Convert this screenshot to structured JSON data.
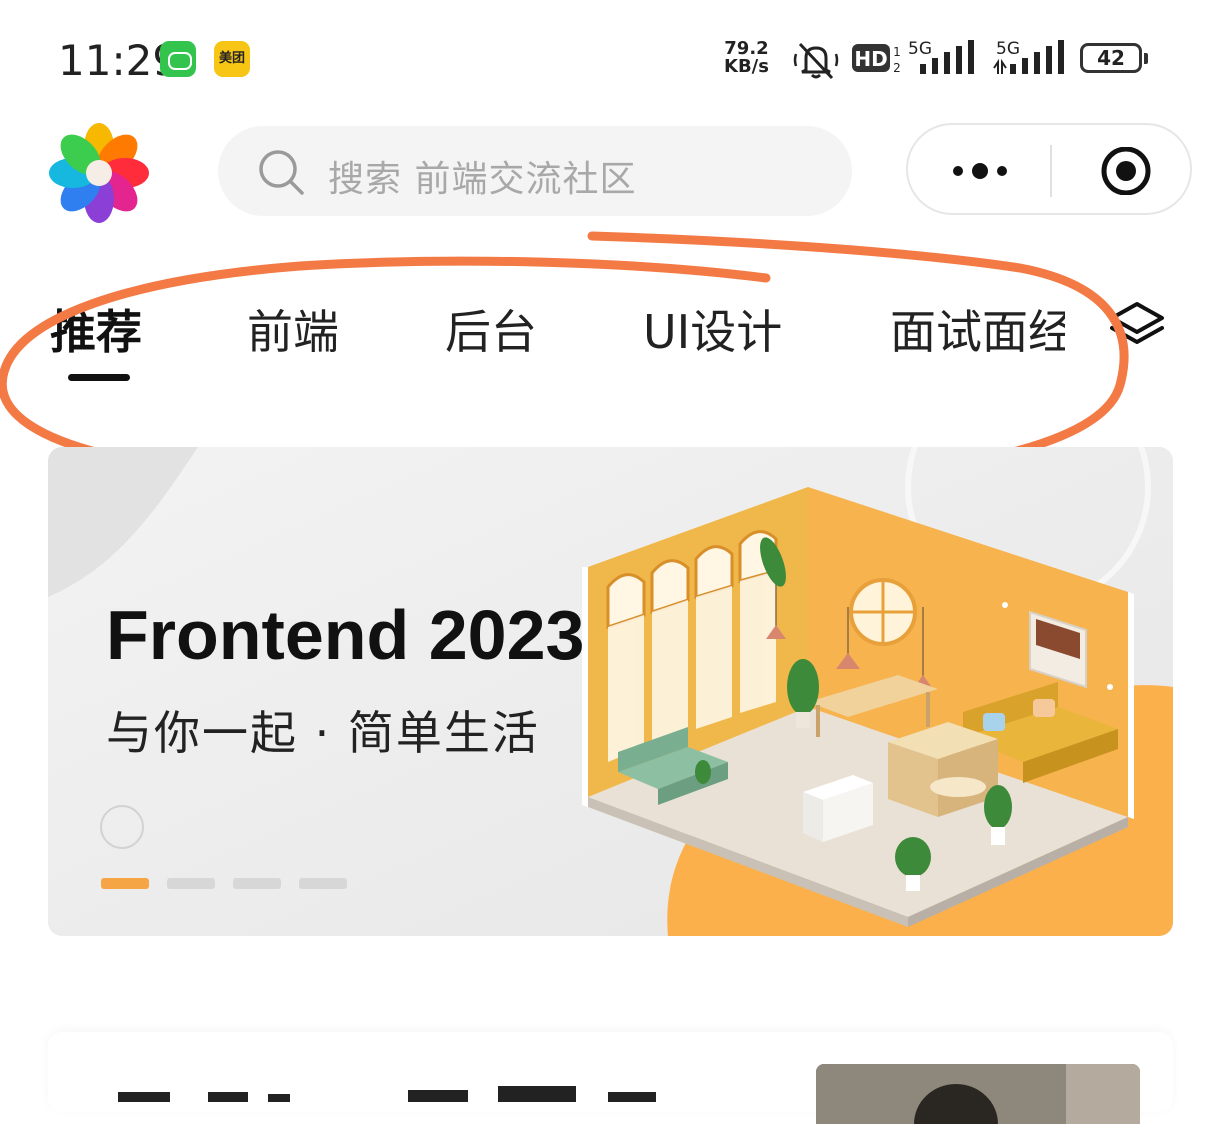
{
  "status_bar": {
    "time": "11:29",
    "app_badge_yellow": "美团",
    "net_speed_value": "79.2",
    "net_speed_unit": "KB/s",
    "hd_label": "HD",
    "signal1_label": "5G",
    "signal2_label": "5G",
    "battery": "42"
  },
  "header": {
    "search_placeholder": "搜索 前端交流社区"
  },
  "tabs": [
    {
      "label": "推荐",
      "active": true
    },
    {
      "label": "前端",
      "active": false
    },
    {
      "label": "后台",
      "active": false
    },
    {
      "label": "UI设计",
      "active": false
    },
    {
      "label": "面试面经",
      "active": false
    }
  ],
  "banner": {
    "title": "Frontend 2023",
    "subtitle": "与你一起 · 简单生活",
    "slides_count": 4,
    "active_slide": 1
  },
  "colors": {
    "accent": "#f6a544",
    "annotation": "#f47a45"
  }
}
